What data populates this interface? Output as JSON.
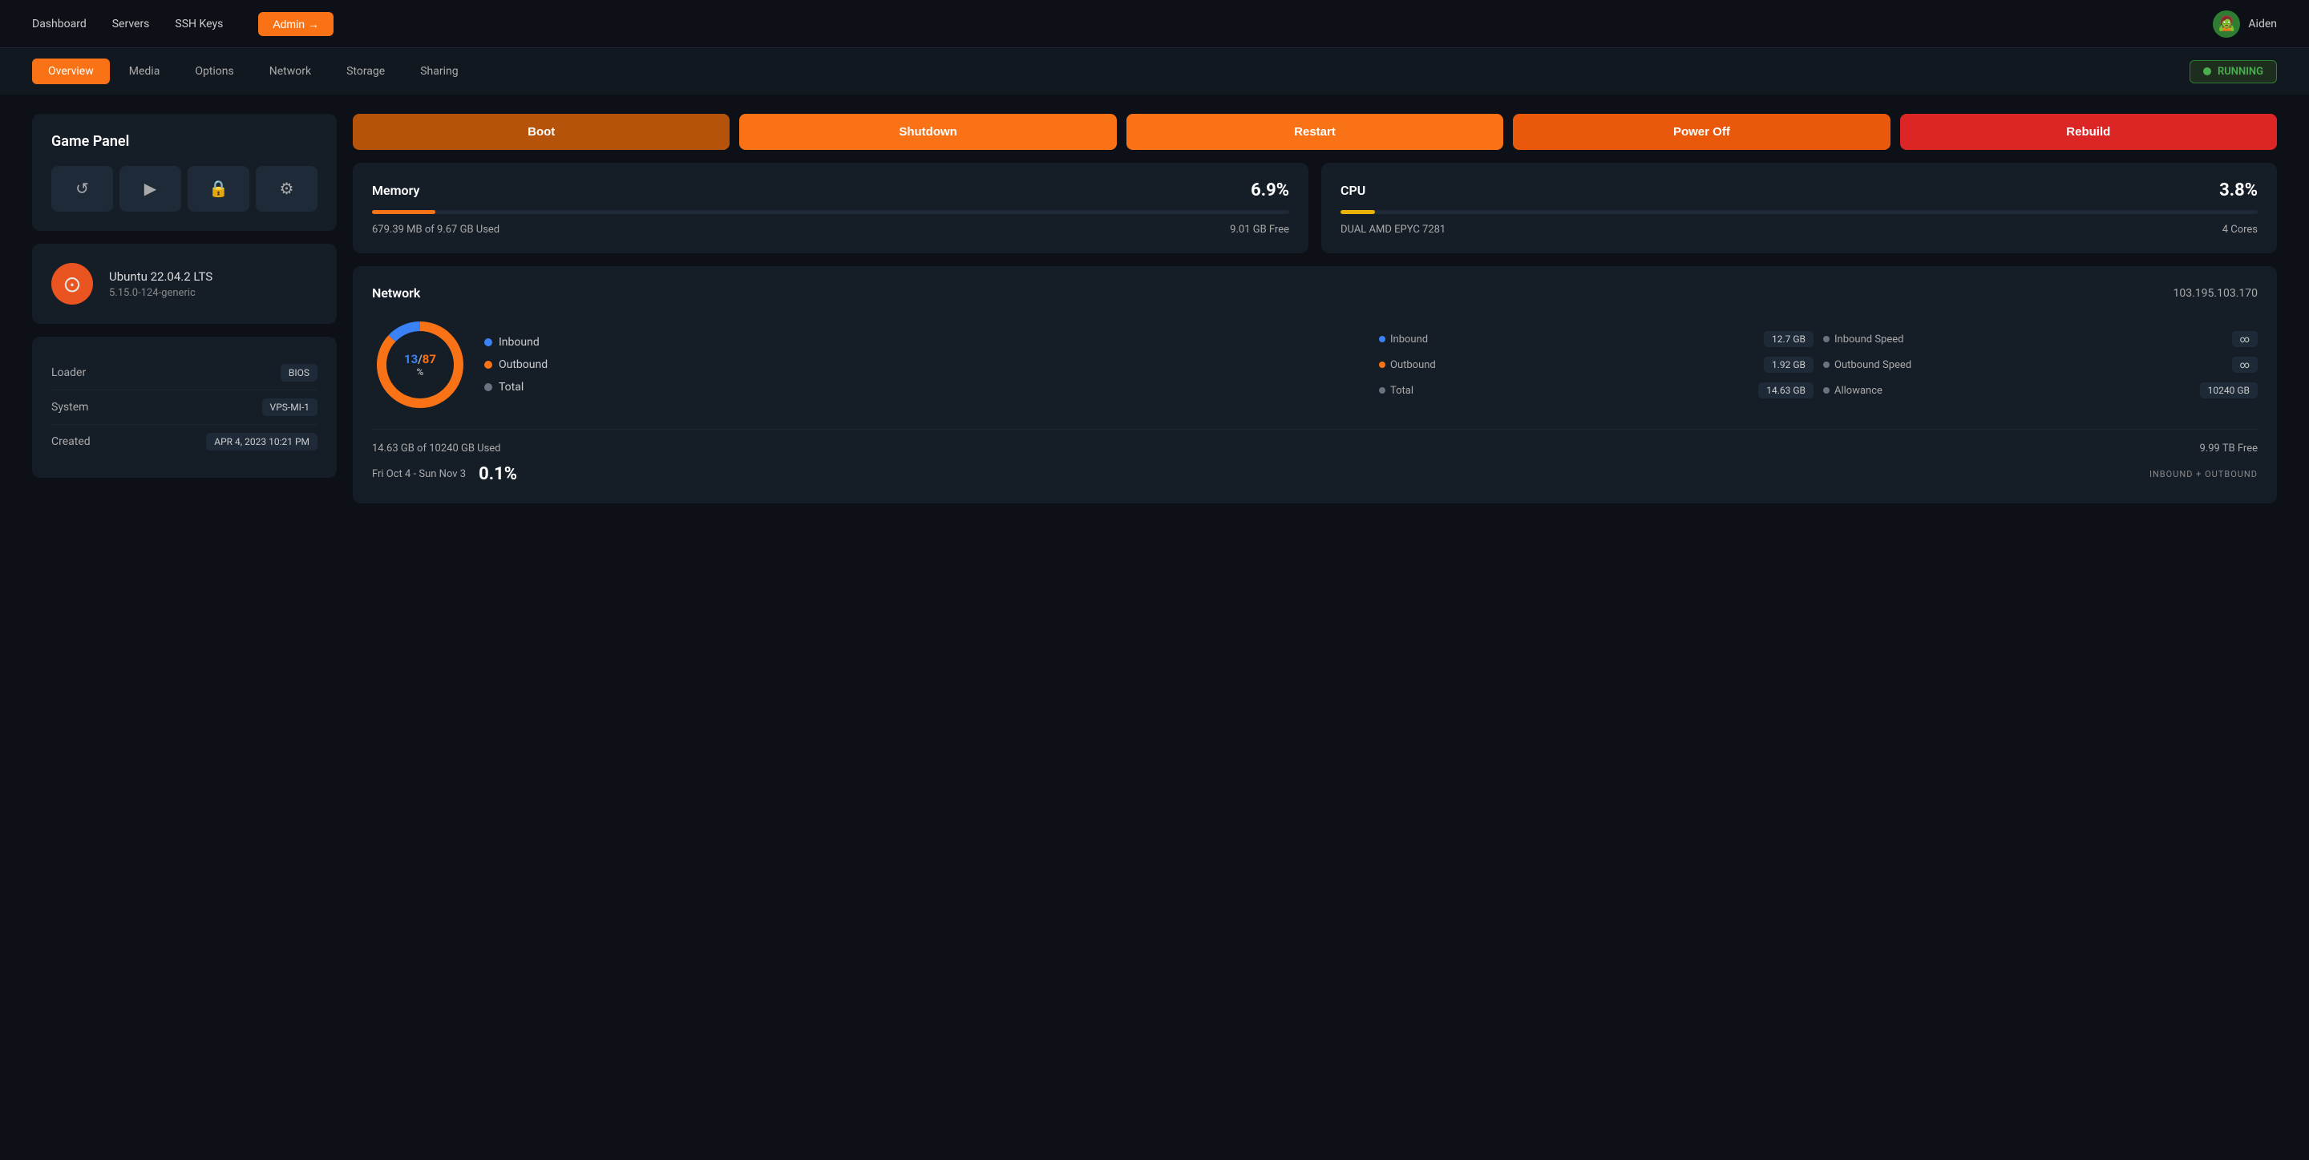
{
  "nav": {
    "links": [
      "Dashboard",
      "Servers",
      "SSH Keys"
    ],
    "admin_label": "Admin →",
    "user": {
      "name": "Aiden",
      "avatar_emoji": "🧟"
    }
  },
  "tabs": [
    {
      "id": "overview",
      "label": "Overview",
      "active": true
    },
    {
      "id": "media",
      "label": "Media",
      "active": false
    },
    {
      "id": "options",
      "label": "Options",
      "active": false
    },
    {
      "id": "network",
      "label": "Network",
      "active": false
    },
    {
      "id": "storage",
      "label": "Storage",
      "active": false
    },
    {
      "id": "sharing",
      "label": "Sharing",
      "active": false
    }
  ],
  "status": {
    "label": "RUNNING"
  },
  "game_panel": {
    "title": "Game Panel",
    "icons": [
      "↺",
      "▶",
      "🔒",
      "⚙"
    ]
  },
  "os": {
    "name": "Ubuntu 22.04.2 LTS",
    "kernel": "5.15.0-124-generic"
  },
  "system_info": {
    "rows": [
      {
        "label": "Loader",
        "value": "BIOS"
      },
      {
        "label": "System",
        "value": "VPS-MI-1"
      },
      {
        "label": "Created",
        "value": "APR 4, 2023 10:21 PM"
      }
    ]
  },
  "actions": {
    "buttons": [
      {
        "id": "boot",
        "label": "Boot",
        "class": "btn-boot"
      },
      {
        "id": "shutdown",
        "label": "Shutdown",
        "class": "btn-shutdown"
      },
      {
        "id": "restart",
        "label": "Restart",
        "class": "btn-restart"
      },
      {
        "id": "poweroff",
        "label": "Power Off",
        "class": "btn-poweroff"
      },
      {
        "id": "rebuild",
        "label": "Rebuild",
        "class": "btn-rebuild"
      }
    ]
  },
  "memory": {
    "title": "Memory",
    "percent": "6.9%",
    "used": "679.39 MB of 9.67 GB Used",
    "free": "9.01 GB Free",
    "bar_width": "6.9"
  },
  "cpu": {
    "title": "CPU",
    "percent": "3.8%",
    "model": "DUAL AMD EPYC 7281",
    "cores": "4 Cores",
    "bar_width": "3.8"
  },
  "network": {
    "title": "Network",
    "ip": "103.195.103.170",
    "donut": {
      "inbound_pct": 13,
      "outbound_pct": 87,
      "label_in": "13",
      "label_out": "87",
      "label_pct": "%"
    },
    "legend": [
      {
        "label": "Inbound",
        "color_class": "dot-blue"
      },
      {
        "label": "Outbound",
        "color_class": "dot-orange"
      },
      {
        "label": "Total",
        "color_class": "dot-gray"
      }
    ],
    "stats": [
      {
        "label": "Inbound",
        "value": "12.7 GB",
        "dot": "#3b82f6"
      },
      {
        "label": "Inbound Speed",
        "value": "∞"
      },
      {
        "label": "Outbound",
        "value": "1.92 GB",
        "dot": "#f97316"
      },
      {
        "label": "Outbound Speed",
        "value": "∞"
      },
      {
        "label": "Total",
        "value": "14.63 GB",
        "dot": "#6b7280"
      },
      {
        "label": "Allowance",
        "value": "10240 GB"
      }
    ],
    "footer": {
      "used": "14.63 GB of 10240 GB Used",
      "free": "9.99 TB Free",
      "date_range": "Fri Oct 4 - Sun Nov 3",
      "pct": "0.1%",
      "suffix": "INBOUND + OUTBOUND"
    }
  }
}
